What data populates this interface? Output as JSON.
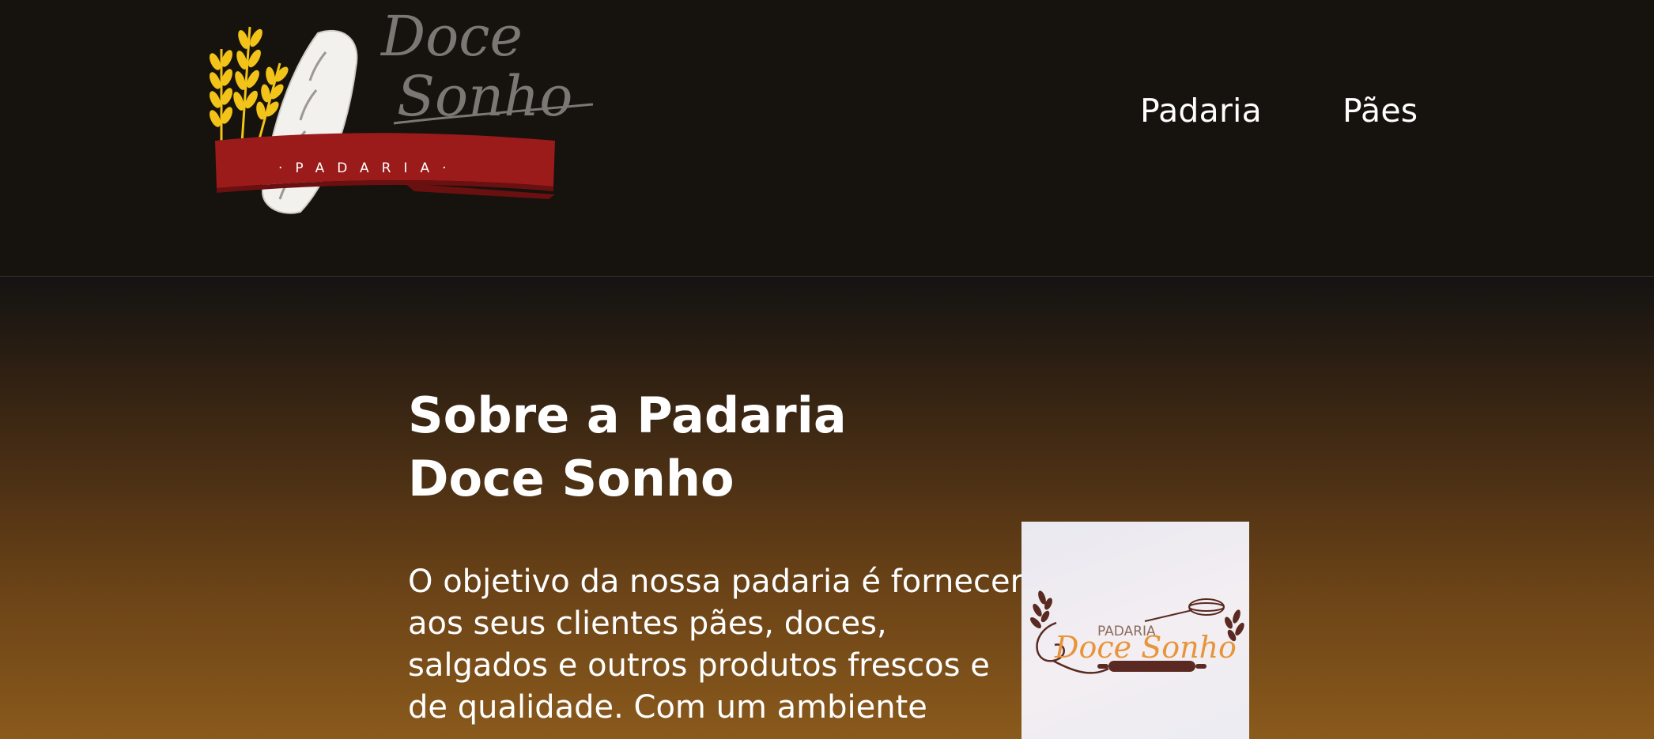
{
  "header": {
    "logo": {
      "brand_line1": "Doce",
      "brand_line2": "Sonho",
      "ribbon_text": "·PADARIA·"
    },
    "nav": [
      {
        "label": "Padaria"
      },
      {
        "label": "Pães"
      }
    ]
  },
  "about": {
    "title": "Sobre a Padaria Doce Sonho",
    "text": "O objetivo da nossa padaria é fornecer aos seus clientes pães, doces, salgados e outros produtos frescos e de qualidade. Com um ambiente",
    "image": {
      "small_label": "PADARIA",
      "brand": "Doce Sonho"
    }
  },
  "colors": {
    "header_bg": "#16120e",
    "ribbon_red": "#9b1a1a",
    "wheat_yellow": "#f2c318",
    "script_gray": "#7a7875",
    "image_orange": "#e8943a",
    "image_brown": "#5a2a22"
  }
}
